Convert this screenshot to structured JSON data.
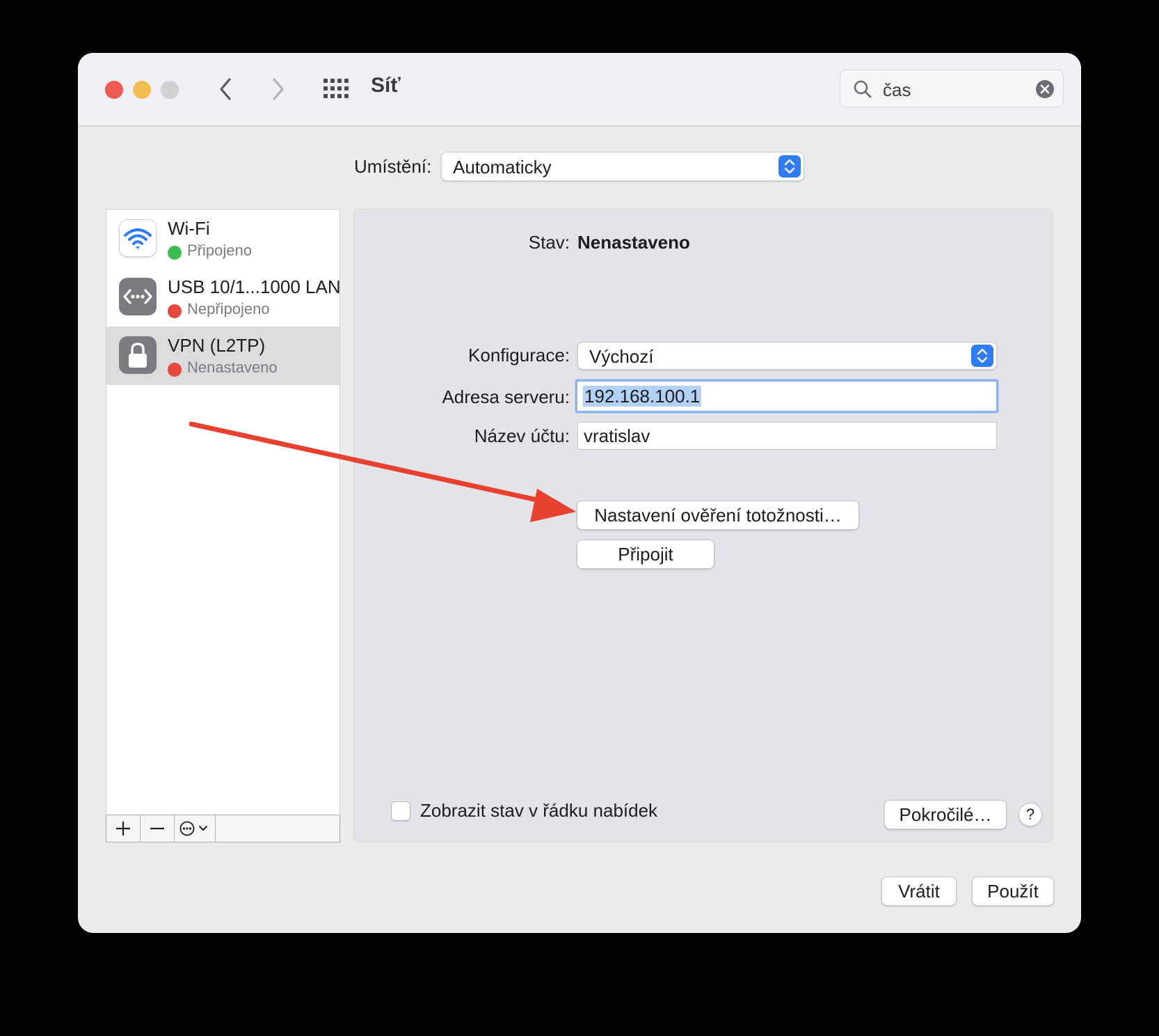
{
  "window": {
    "title": "Síť"
  },
  "search": {
    "value": "čas"
  },
  "location": {
    "label": "Umístění:",
    "value": "Automaticky"
  },
  "services": [
    {
      "name": "Wi-Fi",
      "status": "Připojeno",
      "status_color": "#3fbe4f",
      "icon": "wifi-icon"
    },
    {
      "name": "USB 10/1...1000 LAN",
      "status": "Nepřipojeno",
      "status_color": "#e6483d",
      "icon": "ethernet-icon"
    },
    {
      "name": "VPN (L2TP)",
      "status": "Nenastaveno",
      "status_color": "#e6483d",
      "icon": "lock-icon",
      "selected": true
    }
  ],
  "detail": {
    "status_label": "Stav:",
    "status_value": "Nenastaveno",
    "config_label": "Konfigurace:",
    "config_value": "Výchozí",
    "server_label": "Adresa serveru:",
    "server_value": "192.168.100.1",
    "account_label": "Název účtu:",
    "account_value": "vratislav",
    "auth_button": "Nastavení ověření totožnosti…",
    "connect_button": "Připojit",
    "show_status_label": "Zobrazit stav v řádku nabídek",
    "advanced_button": "Pokročilé…",
    "help_button": "?"
  },
  "footer": {
    "revert_button": "Vrátit",
    "apply_button": "Použít"
  },
  "colors": {
    "accent": "#2f7cf6",
    "annotation_arrow": "#e8402e"
  }
}
